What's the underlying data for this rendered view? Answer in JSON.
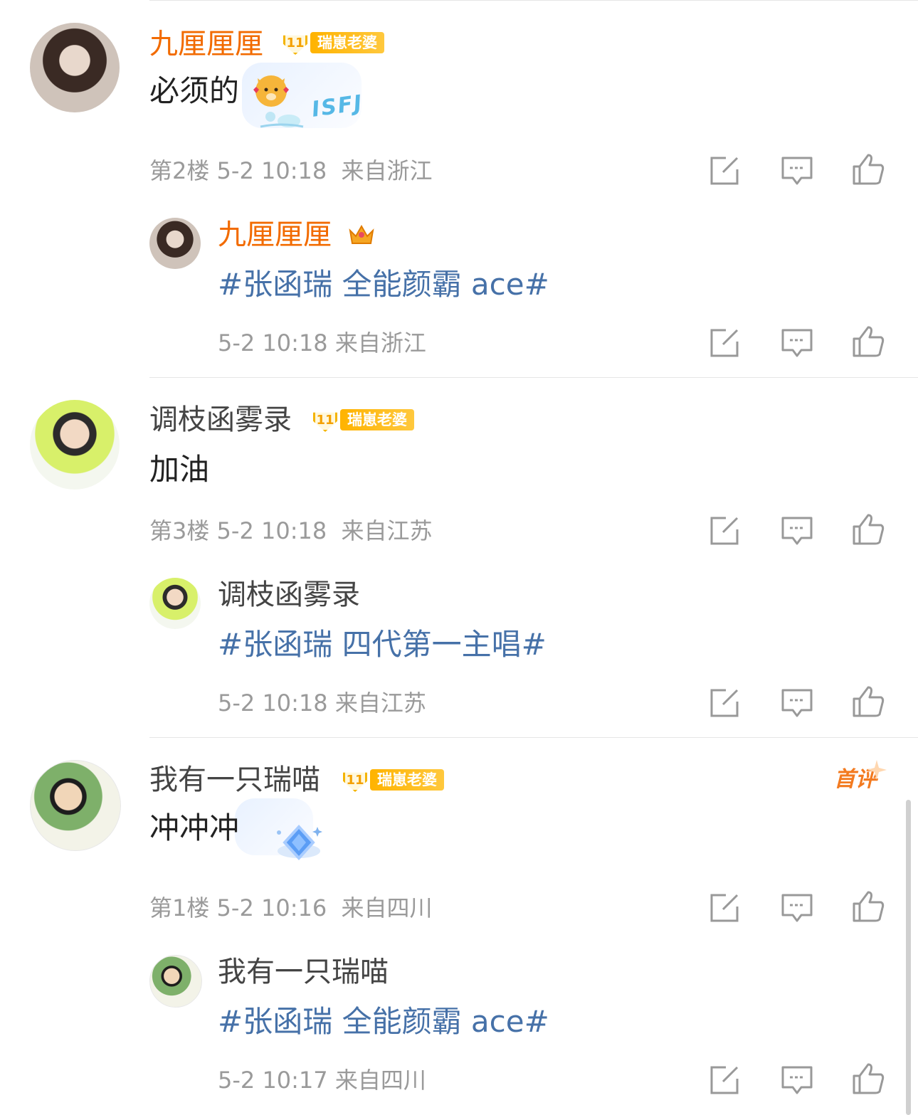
{
  "comments": [
    {
      "author": "九厘厘厘",
      "badge_level": "11",
      "badge_label": "瑞崽老婆",
      "text": "必须的",
      "sticker_text": "ISFJ",
      "floor": "第2楼",
      "time": "5-2 10:18",
      "location": "来自浙江",
      "reply": {
        "author": "九厘厘厘",
        "topic_a": "#张函瑞",
        "topic_b": "全能颜霸 ace#",
        "meta": "5-2 10:18  来自浙江"
      }
    },
    {
      "author": "调枝函雾录",
      "badge_level": "11",
      "badge_label": "瑞崽老婆",
      "text": "加油",
      "floor": "第3楼",
      "time": "5-2 10:18",
      "location": "来自江苏",
      "reply": {
        "author": "调枝函雾录",
        "topic_a": "#张函瑞",
        "topic_b": "四代第一主唱#",
        "meta": "5-2 10:18  来自江苏"
      }
    },
    {
      "author": "我有一只瑞喵",
      "badge_level": "11",
      "badge_label": "瑞崽老婆",
      "first_label": "首评",
      "text": "冲冲冲",
      "floor": "第1楼",
      "time": "5-2 10:16",
      "location": "来自四川",
      "reply": {
        "author": "我有一只瑞喵",
        "topic_a": "#张函瑞",
        "topic_b": "全能颜霸 ace#",
        "meta": "5-2 10:17  来自四川"
      }
    }
  ],
  "icons": [
    "share-icon",
    "comment-icon",
    "like-icon"
  ],
  "colors": {
    "orange_name": "#f26b00",
    "topic_blue": "#4671a8",
    "meta_gray": "#9a9a9a",
    "badge_gold": "#ffb300"
  }
}
